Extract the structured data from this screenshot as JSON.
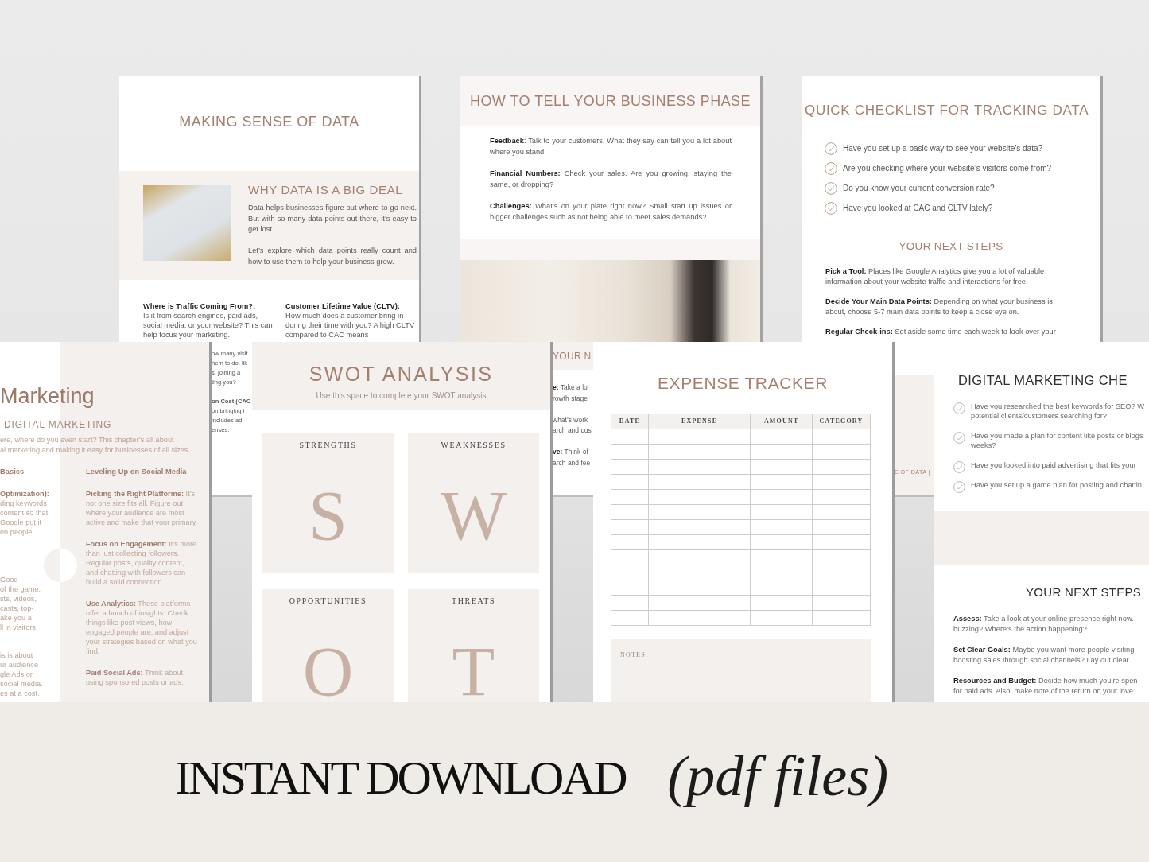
{
  "making_sense_page": {
    "title": "MAKING SENSE OF DATA",
    "feature": {
      "heading": "WHY DATA IS A BIG DEAL",
      "paragraphs": [
        "Data helps businesses figure out where to go next. But with so many data points out there, it’s easy to get lost.",
        "Let’s explore which data points really count and how to use them to help your business grow."
      ]
    },
    "columns": [
      {
        "heading": "Where is Traffic Coming From?:",
        "text": "Is it from search engines, paid ads, social media, or your website? This can help focus your marketing."
      },
      {
        "heading": "Customer Lifetime Value (CLTV):",
        "text": "How much does a customer bring in during their time with you? A high CLTV compared to CAC means"
      }
    ],
    "fragments": [
      {
        "lines": [
          {
            "kind": "line",
            "text": "ow many visit"
          },
          {
            "kind": "line",
            "text": "hem to do, lik"
          },
          {
            "kind": "line",
            "text": "s, joining a"
          },
          {
            "kind": "line",
            "text": "ting you?"
          }
        ]
      },
      {
        "lines": [
          {
            "kind": "heading",
            "text": "on Cost (CAC"
          },
          {
            "kind": "line",
            "text": "on bringing i"
          },
          {
            "kind": "line",
            "text": "includes ad"
          },
          {
            "kind": "line",
            "text": "enses."
          }
        ]
      }
    ]
  },
  "business_phase_page": {
    "title": "HOW TO TELL YOUR BUSINESS PHASE",
    "items": [
      "**Feedback**: Talk to your customers. What they say can tell you a lot about where you stand.",
      "**Financial Numbers:** Check your sales. Are you growing, staying the same, or dropping?",
      "**Challenges:** What’s on your plate right now? Small start up issues or bigger challenges such as not being able to meet sales demands?"
    ],
    "lower_heading": "YOUR N",
    "fragments": [
      {
        "lines": [
          "**e:** Take a lo",
          "rowth stage"
        ]
      },
      {
        "lines": [
          "what’s work",
          "arch and cus"
        ]
      },
      {
        "lines": [
          "**ve:** Think of",
          "arch and fee"
        ]
      }
    ]
  },
  "checklist_page": {
    "title": "QUICK CHECKLIST FOR TRACKING DATA",
    "checks": [
      "Have you set up a basic way to see your website’s data?",
      "Are you checking where your website’s visitors come from?",
      "Do you know your current conversion rate?",
      "Have you looked at CAC and CLTV lately?"
    ],
    "steps_heading": "YOUR NEXT STEPS",
    "steps": [
      "**Pick a Tool:** Places like Google Analytics give you a lot of valuable information about your website traffic and interactions for free.",
      "**Decide Your Main Data Points:** Depending on what your business is about, choose 5-7 main data points to keep a close eye on.",
      "**Regular Check-ins:** Set aside some time each week to look over your"
    ],
    "footer": "E OF DATA |"
  },
  "digital_marketing_page": {
    "title": "Marketing",
    "subtitle": "DIGITAL MARKETING",
    "intro_lines": [
      "ere, where do you even start? This chapter’s all about",
      "al marketing and making it easy for businesses of all sizes."
    ],
    "left_column": {
      "heading": "Basics",
      "groups": [
        {
          "lines": [
            {
              "kind": "heading",
              "text": "Optimization):"
            },
            {
              "kind": "line",
              "text": "ding keywords"
            },
            {
              "kind": "line",
              "text": "content so that"
            },
            {
              "kind": "line",
              "text": "Google put it"
            },
            {
              "kind": "line",
              "text": "en people"
            }
          ]
        },
        {
          "lines": [
            {
              "kind": "line",
              "text": "Good"
            },
            {
              "kind": "line",
              "text": "of the game."
            },
            {
              "kind": "line",
              "text": "sts, videos,"
            },
            {
              "kind": "line",
              "text": "casts, top-"
            },
            {
              "kind": "line",
              "text": "ake you a"
            },
            {
              "kind": "line",
              "text": "ll in visitors."
            }
          ]
        },
        {
          "lines": [
            {
              "kind": "line",
              "text": "is is about"
            },
            {
              "kind": "line",
              "text": "ur audience"
            },
            {
              "kind": "line",
              "text": "gle Ads or"
            },
            {
              "kind": "line",
              "text": "social media."
            },
            {
              "kind": "line",
              "text": "es at a cost."
            }
          ]
        }
      ]
    },
    "right_column": {
      "heading": "Leveling Up on Social Media",
      "items": [
        "**Picking the Right Platforms:** It’s not one size fits all. Figure out where your audience are most active and make that your primary.",
        "**Focus on Engagement:** It’s more than just collecting followers. Regular posts, quality content, and chatting with followers can build a solid connection.",
        "**Use Analytics:** These platforms offer a bunch of insights. Check things like post views, how engaged people are, and adjust your strategies based on what you find.",
        "**Paid Social Ads:** Think about using sponsored posts or ads."
      ]
    }
  },
  "swot_page": {
    "title": "SWOT ANALYSIS",
    "subtitle": "Use this space to complete your SWOT analysis",
    "quadrants": [
      {
        "label": "STRENGTHS",
        "letter": "S"
      },
      {
        "label": "WEAKNESSES",
        "letter": "W"
      },
      {
        "label": "OPPORTUNITIES",
        "letter": "O"
      },
      {
        "label": "THREATS",
        "letter": "T"
      }
    ]
  },
  "expense_page": {
    "title": "EXPENSE TRACKER",
    "columns": [
      "DATE",
      "EXPENSE",
      "AMOUNT",
      "CATEGORY"
    ],
    "rows": [
      {
        "kind": "blank"
      },
      {
        "kind": "blank"
      },
      {
        "kind": "blank"
      },
      {
        "kind": "blank"
      },
      {
        "kind": "blank"
      },
      {
        "kind": "blank"
      },
      {
        "kind": "blank"
      },
      {
        "kind": "blank"
      },
      {
        "kind": "blank"
      },
      {
        "kind": "blank"
      },
      {
        "kind": "blank"
      },
      {
        "kind": "blank"
      },
      {
        "kind": "blank"
      }
    ],
    "notes": {
      "label": "NOTES:"
    }
  },
  "marketing_checklist_page": {
    "title": "DIGITAL MARKETING CHE",
    "checks": [
      {
        "lines": [
          "Have you researched the best keywords for SEO? W",
          "potential clients/customers searching for?"
        ]
      },
      {
        "lines": [
          "Have you made a plan for content like posts or blogs",
          "weeks?"
        ]
      },
      {
        "lines": [
          "Have you looked into paid advertising that fits your"
        ]
      },
      {
        "lines": [
          "Have you set up a game plan for posting and chattin"
        ]
      }
    ],
    "steps_heading": "YOUR NEXT STEPS",
    "steps": [
      {
        "lines": [
          "**Assess:** Take a look at your online presence right now.",
          "buzzing? Where’s the action happening?"
        ]
      },
      {
        "lines": [
          "**Set Clear Goals:** Maybe you want more people visiting",
          "boosting sales through social channels? Lay out clear."
        ]
      },
      {
        "lines": [
          "**Resources and Budget:** Decide how much you’re spen",
          "for paid ads. Also, make note of the return on your inve"
        ]
      }
    ]
  },
  "banner": {
    "headline": "INSTANT DOWNLOAD",
    "note": "(pdf files)"
  }
}
